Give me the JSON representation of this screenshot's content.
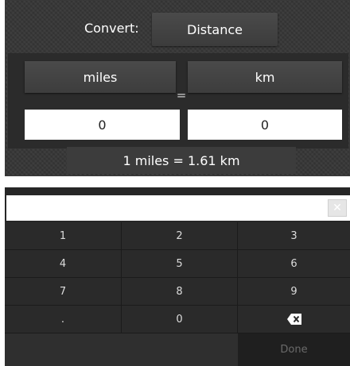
{
  "converter": {
    "convert_label": "Convert:",
    "type_button": "Distance",
    "from_unit": "miles",
    "to_unit": "km",
    "equals": "=",
    "from_value": "0",
    "to_value": "0",
    "result_text": "1 miles = 1.61 km"
  },
  "keypad": {
    "entry_value": "",
    "clear_glyph": "✕",
    "keys": [
      {
        "label": "1",
        "name": "key-1"
      },
      {
        "label": "2",
        "name": "key-2"
      },
      {
        "label": "3",
        "name": "key-3"
      },
      {
        "label": "4",
        "name": "key-4"
      },
      {
        "label": "5",
        "name": "key-5"
      },
      {
        "label": "6",
        "name": "key-6"
      },
      {
        "label": "7",
        "name": "key-7"
      },
      {
        "label": "8",
        "name": "key-8"
      },
      {
        "label": "9",
        "name": "key-9"
      },
      {
        "label": ".",
        "name": "key-decimal"
      },
      {
        "label": "0",
        "name": "key-0"
      },
      {
        "icon": "backspace-icon",
        "name": "key-backspace"
      }
    ],
    "done_label": "Done"
  },
  "colors": {
    "panel": "#363636",
    "keypad": "#262626",
    "done_disabled_text": "#6a6a6a"
  }
}
